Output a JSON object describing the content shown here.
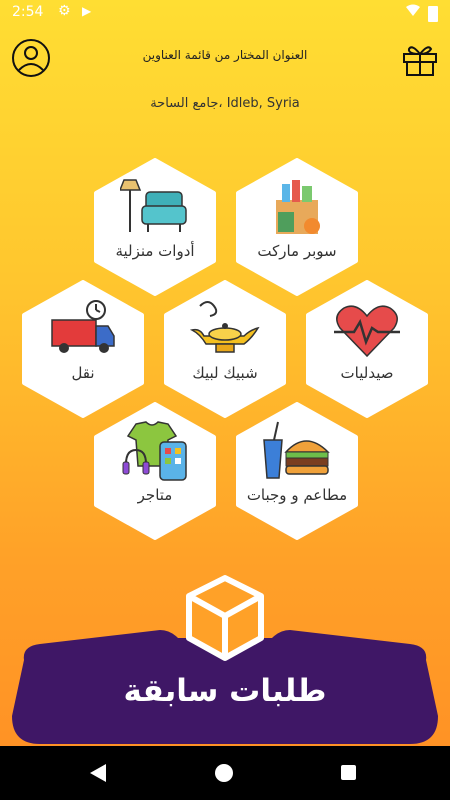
{
  "status_bar": {
    "time": "2:54",
    "icons": [
      "gear-icon",
      "play-store-icon",
      "wifi-icon",
      "battery-icon"
    ]
  },
  "header": {
    "address_title": "العنوان المختار من قائمة العناوين",
    "address_value": "جامع الساحة، Idleb, Syria",
    "left_icon": "user-avatar-icon",
    "right_icon": "gift-icon"
  },
  "categories": [
    {
      "label": "سوبر ماركت",
      "icon": "grocery-bag-icon"
    },
    {
      "label": "أدوات منزلية",
      "icon": "furniture-icon"
    },
    {
      "label": "صيدليات",
      "icon": "heart-pulse-icon"
    },
    {
      "label": "شبيك لبيك",
      "icon": "magic-lamp-icon"
    },
    {
      "label": "نقل",
      "icon": "delivery-truck-icon"
    },
    {
      "label": "مطاعم و وجبات",
      "icon": "burger-drink-icon"
    },
    {
      "label": "متاجر",
      "icon": "clothes-phone-icon"
    }
  ],
  "previous_orders": {
    "label": "طلبات سابقة",
    "icon": "box-icon"
  },
  "colors": {
    "accent_purple": "#3F1766",
    "gradient_top": "#FFDE33",
    "gradient_bottom": "#FF8E24"
  }
}
